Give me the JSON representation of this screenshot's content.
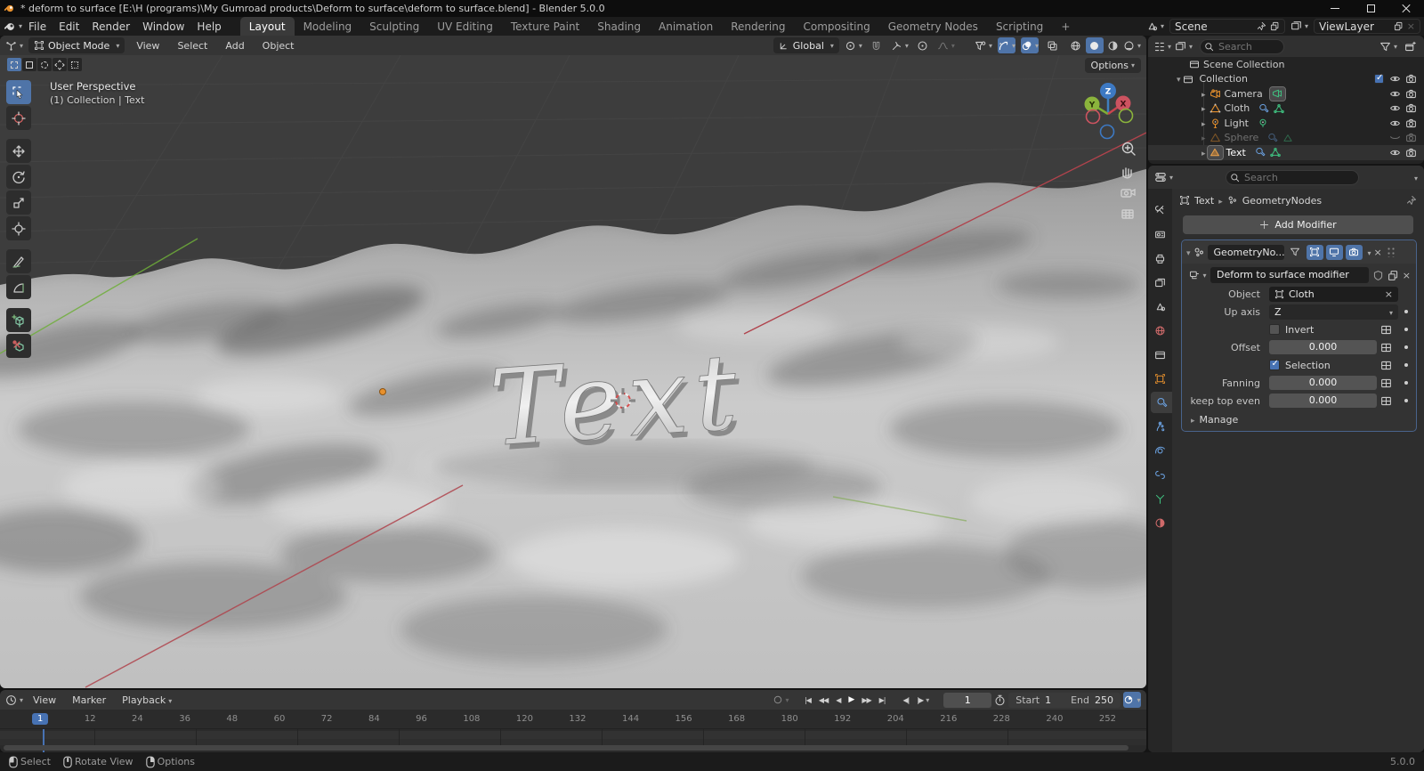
{
  "titlebar": {
    "title": "* deform to surface [E:\\H (programs)\\My Gumroad products\\Deform to surface\\deform to surface.blend] - Blender 5.0.0"
  },
  "topbar": {
    "menus": [
      "File",
      "Edit",
      "Render",
      "Window",
      "Help"
    ],
    "tabs": [
      "Layout",
      "Modeling",
      "Sculpting",
      "UV Editing",
      "Texture Paint",
      "Shading",
      "Animation",
      "Rendering",
      "Compositing",
      "Geometry Nodes",
      "Scripting"
    ],
    "add_tab": "+",
    "scene_selector": {
      "label": "Scene"
    },
    "viewlayer_selector": {
      "label": "ViewLayer"
    }
  },
  "viewport": {
    "header": {
      "mode": "Object Mode",
      "menus": [
        "View",
        "Select",
        "Add",
        "Object"
      ],
      "orientation": "Global"
    },
    "overlay": {
      "line1": "User Perspective",
      "line2": "(1) Collection | Text"
    },
    "options_label": "Options",
    "gizmo": {
      "x": "X",
      "y": "Y",
      "z": "Z"
    },
    "scene_text": "Text"
  },
  "outliner": {
    "search_placeholder": "Search",
    "rows": [
      {
        "label": "Scene Collection"
      },
      {
        "label": "Collection"
      },
      {
        "label": "Camera"
      },
      {
        "label": "Cloth"
      },
      {
        "label": "Light"
      },
      {
        "label": "Sphere"
      },
      {
        "label": "Text"
      }
    ]
  },
  "properties": {
    "search_placeholder": "Search",
    "breadcrumb": {
      "object": "Text",
      "node_group": "GeometryNodes"
    },
    "add_modifier_label": "Add Modifier",
    "modifier": {
      "name": "GeometryNo...",
      "group_name": "Deform to surface modifier",
      "object_label": "Object",
      "object_value": "Cloth",
      "up_axis_label": "Up axis",
      "up_axis_value": "Z",
      "invert_label": "Invert",
      "offset_label": "Offset",
      "offset_value": "0.000",
      "selection_label": "Selection",
      "fanning_label": "Fanning",
      "fanning_value": "0.000",
      "keep_top_label": "keep top even",
      "keep_top_value": "0.000",
      "manage_label": "Manage"
    }
  },
  "timeline": {
    "menus": [
      "View",
      "Marker",
      "Playback"
    ],
    "current_frame": "1",
    "start_label": "Start",
    "start_value": "1",
    "end_label": "End",
    "end_value": "250",
    "ticks": [
      "1",
      "12",
      "24",
      "36",
      "48",
      "60",
      "72",
      "84",
      "96",
      "108",
      "120",
      "132",
      "144",
      "156",
      "168",
      "180",
      "192",
      "204",
      "216",
      "228",
      "240",
      "252"
    ]
  },
  "statusbar": {
    "hints": [
      {
        "label": "Select"
      },
      {
        "label": "Rotate View"
      },
      {
        "label": "Options"
      }
    ],
    "version": "5.0.0"
  },
  "colors": {
    "accent": "#4772b3",
    "object_orange": "#e8912d",
    "modifier_blue": "#6ba1e0",
    "data_green": "#3fbf7f",
    "axis_x": "#c8464f",
    "axis_y": "#6fae3a",
    "axis_z": "#3f7fbf"
  }
}
